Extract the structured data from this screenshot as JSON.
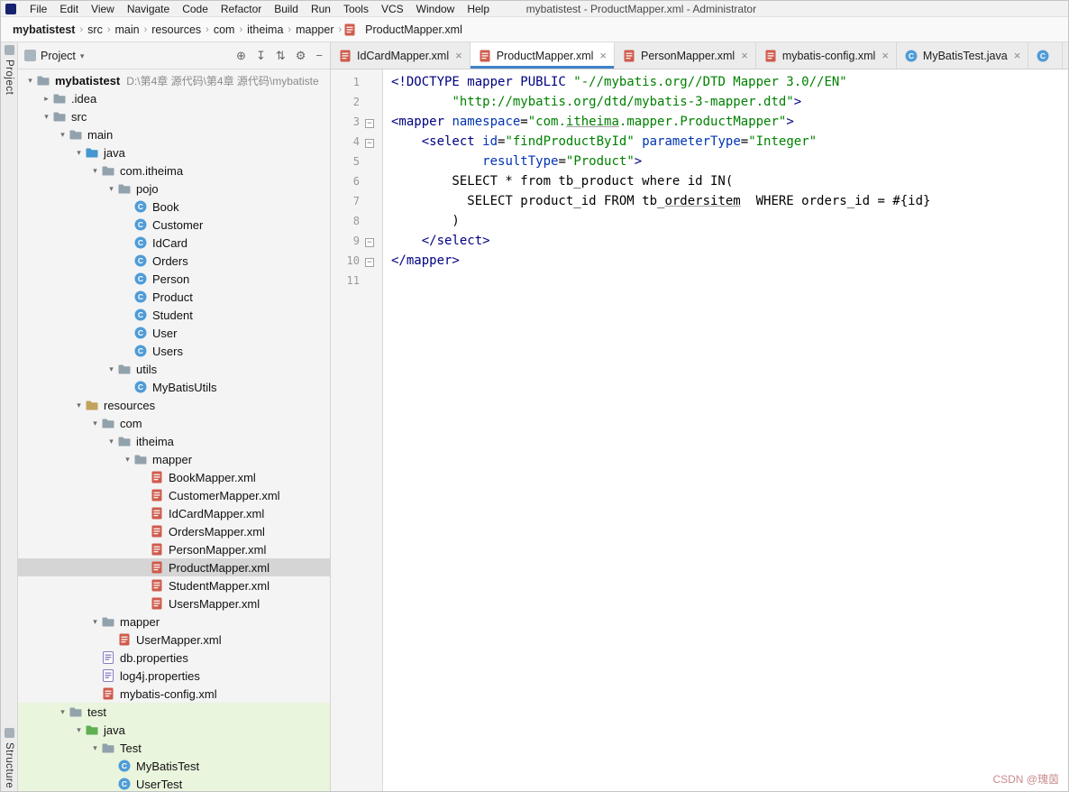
{
  "window": {
    "title": "mybatistest - ProductMapper.xml - Administrator"
  },
  "menubar": {
    "items": [
      "File",
      "Edit",
      "View",
      "Navigate",
      "Code",
      "Refactor",
      "Build",
      "Run",
      "Tools",
      "VCS",
      "Window",
      "Help"
    ]
  },
  "breadcrumbs": {
    "items": [
      {
        "label": "mybatistest",
        "bold": true
      },
      {
        "label": "src"
      },
      {
        "label": "main"
      },
      {
        "label": "resources"
      },
      {
        "label": "com"
      },
      {
        "label": "itheima"
      },
      {
        "label": "mapper"
      },
      {
        "label": "ProductMapper.xml",
        "icon": "xml"
      }
    ]
  },
  "tool_stripes": {
    "left_top": "Project",
    "left_bottom": "Structure"
  },
  "project_panel": {
    "title": "Project",
    "toolbar": [
      {
        "name": "locate",
        "glyph": "⊕"
      },
      {
        "name": "expand-all",
        "glyph": "↧"
      },
      {
        "name": "collapse-all",
        "glyph": "⇅"
      },
      {
        "name": "settings",
        "glyph": "⚙"
      },
      {
        "name": "hide-panel",
        "glyph": "−"
      }
    ],
    "tree": [
      {
        "label": "mybatistest",
        "hint": "D:\\第4章 源代码\\第4章 源代码\\mybatiste",
        "icon": "folder",
        "indent": 0,
        "chev": "open",
        "bold": true
      },
      {
        "label": ".idea",
        "icon": "folder",
        "indent": 1,
        "chev": "closed"
      },
      {
        "label": "src",
        "icon": "folder",
        "indent": 1,
        "chev": "open"
      },
      {
        "label": "main",
        "icon": "folder",
        "indent": 2,
        "chev": "open"
      },
      {
        "label": "java",
        "icon": "folder-src",
        "indent": 3,
        "chev": "open"
      },
      {
        "label": "com.itheima",
        "icon": "package",
        "indent": 4,
        "chev": "open"
      },
      {
        "label": "pojo",
        "icon": "package",
        "indent": 5,
        "chev": "open"
      },
      {
        "label": "Book",
        "icon": "class",
        "indent": 6
      },
      {
        "label": "Customer",
        "icon": "class",
        "indent": 6
      },
      {
        "label": "IdCard",
        "icon": "class",
        "indent": 6
      },
      {
        "label": "Orders",
        "icon": "class",
        "indent": 6
      },
      {
        "label": "Person",
        "icon": "class",
        "indent": 6
      },
      {
        "label": "Product",
        "icon": "class",
        "indent": 6
      },
      {
        "label": "Student",
        "icon": "class",
        "indent": 6
      },
      {
        "label": "User",
        "icon": "class",
        "indent": 6
      },
      {
        "label": "Users",
        "icon": "class",
        "indent": 6
      },
      {
        "label": "utils",
        "icon": "package",
        "indent": 5,
        "chev": "open"
      },
      {
        "label": "MyBatisUtils",
        "icon": "class",
        "indent": 6
      },
      {
        "label": "resources",
        "icon": "folder-res",
        "indent": 3,
        "chev": "open"
      },
      {
        "label": "com",
        "icon": "package",
        "indent": 4,
        "chev": "open"
      },
      {
        "label": "itheima",
        "icon": "package",
        "indent": 5,
        "chev": "open"
      },
      {
        "label": "mapper",
        "icon": "package",
        "indent": 6,
        "chev": "open"
      },
      {
        "label": "BookMapper.xml",
        "icon": "xml",
        "indent": 7
      },
      {
        "label": "CustomerMapper.xml",
        "icon": "xml",
        "indent": 7
      },
      {
        "label": "IdCardMapper.xml",
        "icon": "xml",
        "indent": 7
      },
      {
        "label": "OrdersMapper.xml",
        "icon": "xml",
        "indent": 7
      },
      {
        "label": "PersonMapper.xml",
        "icon": "xml",
        "indent": 7
      },
      {
        "label": "ProductMapper.xml",
        "icon": "xml",
        "indent": 7,
        "selected": true
      },
      {
        "label": "StudentMapper.xml",
        "icon": "xml",
        "indent": 7
      },
      {
        "label": "UsersMapper.xml",
        "icon": "xml",
        "indent": 7
      },
      {
        "label": "mapper",
        "icon": "package",
        "indent": 4,
        "chev": "open"
      },
      {
        "label": "UserMapper.xml",
        "icon": "xml",
        "indent": 5
      },
      {
        "label": "db.properties",
        "icon": "props",
        "indent": 4
      },
      {
        "label": "log4j.properties",
        "icon": "props",
        "indent": 4
      },
      {
        "label": "mybatis-config.xml",
        "icon": "xml",
        "indent": 4
      },
      {
        "label": "test",
        "icon": "folder",
        "indent": 2,
        "chev": "open",
        "green": true
      },
      {
        "label": "java",
        "icon": "folder-test",
        "indent": 3,
        "chev": "open",
        "green": true
      },
      {
        "label": "Test",
        "icon": "package",
        "indent": 4,
        "chev": "open",
        "green": true
      },
      {
        "label": "MyBatisTest",
        "icon": "class",
        "indent": 5,
        "green": true
      },
      {
        "label": "UserTest",
        "icon": "class",
        "indent": 5,
        "green": true
      }
    ]
  },
  "editor": {
    "tabs": [
      {
        "label": "IdCardMapper.xml",
        "icon": "xml",
        "active": false,
        "closable": true
      },
      {
        "label": "ProductMapper.xml",
        "icon": "xml",
        "active": true,
        "closable": true
      },
      {
        "label": "PersonMapper.xml",
        "icon": "xml",
        "active": false,
        "closable": true
      },
      {
        "label": "mybatis-config.xml",
        "icon": "xml",
        "active": false,
        "closable": true
      },
      {
        "label": "MyBatisTest.java",
        "icon": "class",
        "active": false,
        "closable": true
      },
      {
        "label": "",
        "icon": "class",
        "active": false,
        "closable": false,
        "partial": true
      }
    ],
    "lines": [
      {
        "n": 1,
        "fold": false,
        "segs": [
          {
            "t": "<!DOCTYPE mapper PUBLIC ",
            "c": "tag"
          },
          {
            "t": "\"-//mybatis.org//DTD Mapper 3.0//EN\"",
            "c": "str"
          }
        ]
      },
      {
        "n": 2,
        "fold": false,
        "segs": [
          {
            "t": "        ",
            "c": "txt"
          },
          {
            "t": "\"http://mybatis.org/dtd/mybatis-3-mapper.dtd\"",
            "c": "str"
          },
          {
            "t": ">",
            "c": "tag"
          }
        ]
      },
      {
        "n": 3,
        "fold": true,
        "segs": [
          {
            "t": "<mapper ",
            "c": "tag"
          },
          {
            "t": "namespace",
            "c": "attr"
          },
          {
            "t": "=",
            "c": "txt"
          },
          {
            "t": "\"com.",
            "c": "str"
          },
          {
            "t": "itheima",
            "c": "str",
            "u": true
          },
          {
            "t": ".mapper.ProductMapper\"",
            "c": "str"
          },
          {
            "t": ">",
            "c": "tag"
          }
        ]
      },
      {
        "n": 4,
        "fold": true,
        "segs": [
          {
            "t": "    ",
            "c": "txt"
          },
          {
            "t": "<select ",
            "c": "tag"
          },
          {
            "t": "id",
            "c": "attr"
          },
          {
            "t": "=",
            "c": "txt"
          },
          {
            "t": "\"findProductById\"",
            "c": "str"
          },
          {
            "t": " ",
            "c": "txt"
          },
          {
            "t": "parameterType",
            "c": "attr"
          },
          {
            "t": "=",
            "c": "txt"
          },
          {
            "t": "\"Integer\"",
            "c": "str"
          }
        ]
      },
      {
        "n": 5,
        "fold": false,
        "segs": [
          {
            "t": "            ",
            "c": "txt"
          },
          {
            "t": "resultType",
            "c": "attr"
          },
          {
            "t": "=",
            "c": "txt"
          },
          {
            "t": "\"Product\"",
            "c": "str"
          },
          {
            "t": ">",
            "c": "tag"
          }
        ]
      },
      {
        "n": 6,
        "fold": false,
        "segs": [
          {
            "t": "        SELECT * from tb_product where id IN(",
            "c": "txt"
          }
        ]
      },
      {
        "n": 7,
        "fold": false,
        "segs": [
          {
            "t": "          SELECT product_id FROM tb_",
            "c": "txt"
          },
          {
            "t": "ordersitem",
            "c": "txt",
            "u": true
          },
          {
            "t": "  WHERE orders_id = #{id}",
            "c": "txt"
          }
        ]
      },
      {
        "n": 8,
        "fold": false,
        "segs": [
          {
            "t": "        )",
            "c": "txt"
          }
        ]
      },
      {
        "n": 9,
        "fold": true,
        "segs": [
          {
            "t": "    ",
            "c": "txt"
          },
          {
            "t": "</select>",
            "c": "tag"
          }
        ]
      },
      {
        "n": 10,
        "fold": true,
        "segs": [
          {
            "t": "</mapper>",
            "c": "tag"
          }
        ]
      },
      {
        "n": 11,
        "fold": false,
        "segs": []
      }
    ]
  },
  "watermark": "CSDN @瑰茵",
  "colors": {
    "accent": "#4083c9",
    "selection_bg": "#d5d5d5",
    "test_scope_bg": "#e9f5dd",
    "xml_tag": "#000080",
    "xml_attr": "#0033b3",
    "xml_string": "#008000",
    "editor_bg": "#ffffff",
    "panel_bg": "#f4f4f4"
  }
}
